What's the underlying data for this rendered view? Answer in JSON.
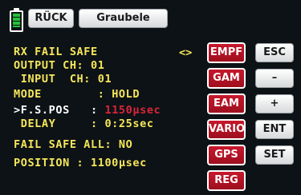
{
  "header": {
    "back_label": "RÜCK",
    "model_name": "Graubele",
    "battery_icon": "battery-icon",
    "battery_level": 1.0
  },
  "menu": {
    "title": "RX FAIL SAFE",
    "nav_arrows": "<>",
    "output_ch": "OUTPUT CH: 01",
    "input_ch": " INPUT  CH: 01",
    "mode_label": "MODE        : ",
    "mode_value": "HOLD",
    "fspos_label": ">F.S.POS   : ",
    "fspos_value": "1150µsec",
    "delay": " DELAY     : 0:25sec",
    "fail_safe_all": "FAIL SAFE ALL: NO",
    "position": "POSITION : 1100µsec"
  },
  "buttons_red": [
    "EMPF",
    "GAM",
    "EAM",
    "VARIO",
    "GPS",
    "REG"
  ],
  "buttons_gray": [
    "ESC",
    "–",
    "+",
    "ENT",
    "SET"
  ],
  "colors": {
    "background": "#0d1216",
    "text_yellow": "#f5e75a",
    "value_red": "#d8263a",
    "button_red": "#b8142a",
    "battery_green": "#25c03b"
  }
}
